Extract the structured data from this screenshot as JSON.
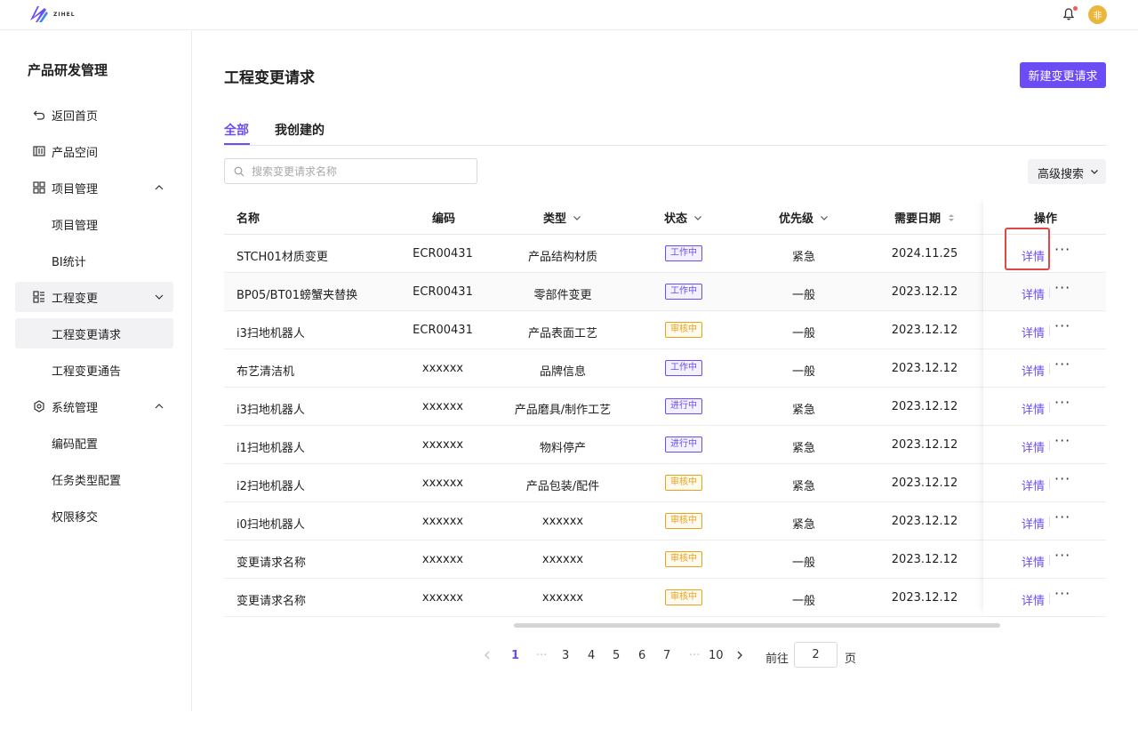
{
  "brand": {
    "name": "ZIHEL",
    "accent": "#6c4cf5"
  },
  "header": {
    "avatar_text": "非"
  },
  "sidebar": {
    "title": "产品研发管理",
    "items": [
      {
        "label": "返回首页",
        "icon": "back-arrow-icon"
      },
      {
        "label": "产品空间",
        "icon": "library-icon"
      },
      {
        "label": "项目管理",
        "icon": "grid-icon",
        "expanded": true
      },
      {
        "label": "项目管理"
      },
      {
        "label": "BI统计"
      },
      {
        "label": "工程变更",
        "icon": "list-grid-icon",
        "expanded": false
      },
      {
        "label": "工程变更请求",
        "active": true
      },
      {
        "label": "工程变更通告"
      },
      {
        "label": "系统管理",
        "icon": "gear-icon",
        "expanded": true
      },
      {
        "label": "编码配置"
      },
      {
        "label": "任务类型配置"
      },
      {
        "label": "权限移交"
      }
    ]
  },
  "main": {
    "title": "工程变更请求",
    "new_button": "新建变更请求",
    "tabs": [
      {
        "label": "全部",
        "active": true
      },
      {
        "label": "我创建的"
      }
    ],
    "search": {
      "placeholder": "搜索变更请求名称",
      "value": ""
    },
    "advanced_search": "高级搜索"
  },
  "table": {
    "columns": [
      "名称",
      "编码",
      "类型",
      "状态",
      "优先级",
      "需要日期",
      "操作"
    ],
    "rows": [
      {
        "name": "STCH01材质变更",
        "code": "ECR00431",
        "type": "产品结构材质",
        "status": "工作中",
        "priority": "紧急",
        "date": "2024.11.25",
        "action": "详情"
      },
      {
        "name": "BP05/BT01螃蟹夹替换",
        "code": "ECR00431",
        "type": "零部件变更",
        "status": "工作中",
        "priority": "一般",
        "date": "2023.12.12",
        "action": "详情"
      },
      {
        "name": "i3扫地机器人",
        "code": "ECR00431",
        "type": "产品表面工艺",
        "status": "审核中",
        "priority": "一般",
        "date": "2023.12.12",
        "action": "详情"
      },
      {
        "name": "布艺清洁机",
        "code": "xxxxxx",
        "type": "品牌信息",
        "status": "工作中",
        "priority": "一般",
        "date": "2023.12.12",
        "action": "详情"
      },
      {
        "name": "i3扫地机器人",
        "code": "xxxxxx",
        "type": "产品磨具/制作工艺",
        "status": "进行中",
        "priority": "紧急",
        "date": "2023.12.12",
        "action": "详情"
      },
      {
        "name": "i1扫地机器人",
        "code": "xxxxxx",
        "type": "物料停产",
        "status": "进行中",
        "priority": "紧急",
        "date": "2023.12.12",
        "action": "详情"
      },
      {
        "name": "i2扫地机器人",
        "code": "xxxxxx",
        "type": "产品包装/配件",
        "status": "审核中",
        "priority": "紧急",
        "date": "2023.12.12",
        "action": "详情"
      },
      {
        "name": "i0扫地机器人",
        "code": "xxxxxx",
        "type": "xxxxxx",
        "status": "审核中",
        "priority": "紧急",
        "date": "2023.12.12",
        "action": "详情"
      },
      {
        "name": "变更请求名称",
        "code": "xxxxxx",
        "type": "xxxxxx",
        "status": "审核中",
        "priority": "一般",
        "date": "2023.12.12",
        "action": "详情"
      },
      {
        "name": "变更请求名称",
        "code": "xxxxxx",
        "type": "xxxxxx",
        "status": "审核中",
        "priority": "一般",
        "date": "2023.12.12",
        "action": "详情"
      }
    ],
    "status_colors": {
      "工作中": "#6c4cf5",
      "进行中": "#6c4cf5",
      "审核中": "#e8a317"
    }
  },
  "pagination": {
    "pages": [
      "1",
      "···",
      "3",
      "4",
      "5",
      "6",
      "7",
      "···",
      "10"
    ],
    "current": "1",
    "goto_label": "前往",
    "goto_value": "2",
    "page_suffix": "页"
  }
}
